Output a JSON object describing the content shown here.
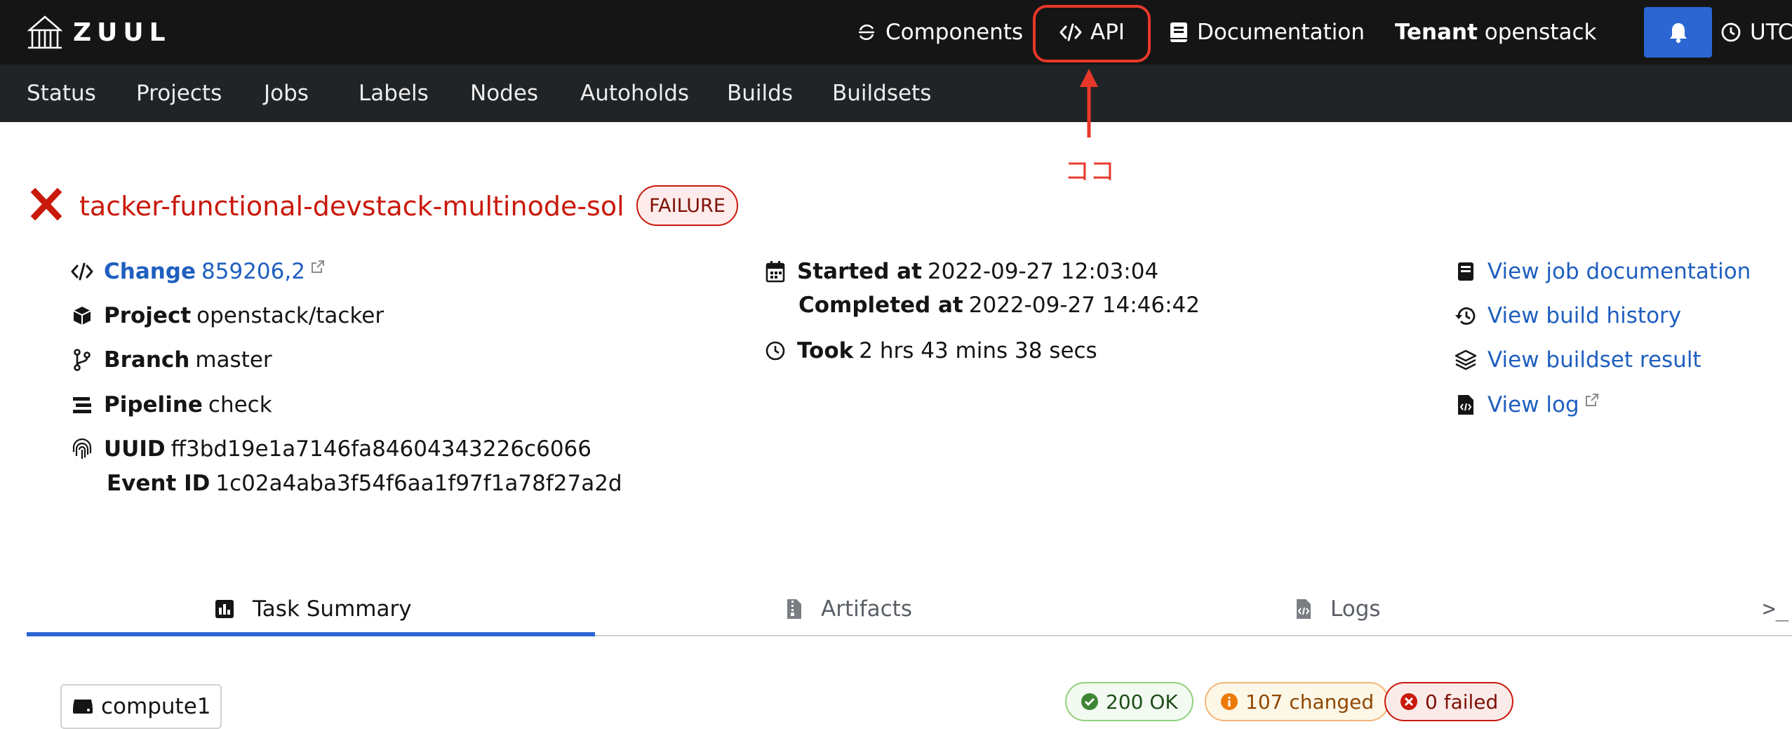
{
  "masthead": {
    "logo_text": "ZUUL",
    "components_label": "Components",
    "api_label": "API",
    "documentation_label": "Documentation",
    "tenant_prefix": "Tenant",
    "tenant_name": "openstack",
    "timezone_label": "UTC"
  },
  "nav": {
    "items": [
      "Status",
      "Projects",
      "Jobs",
      "Labels",
      "Nodes",
      "Autoholds",
      "Builds",
      "Buildsets"
    ]
  },
  "annotation": {
    "label": "ココ",
    "color": "#e8382a"
  },
  "build": {
    "job_name": "tacker-functional-devstack-multinode-sol",
    "result": "FAILURE",
    "change_label": "Change",
    "change_value": "859206,2",
    "project_label": "Project",
    "project_value": "openstack/tacker",
    "branch_label": "Branch",
    "branch_value": "master",
    "pipeline_label": "Pipeline",
    "pipeline_value": "check",
    "uuid_label": "UUID",
    "uuid_value": "ff3bd19e1a7146fa84604343226c6066",
    "event_id_label": "Event ID",
    "event_id_value": "1c02a4aba3f54f6aa1f97f1a78f27a2d",
    "started_label": "Started at",
    "started_value": "2022-09-27 12:03:04",
    "completed_label": "Completed at",
    "completed_value": "2022-09-27 14:46:42",
    "took_label": "Took",
    "took_value": "2 hrs 43 mins 38 secs"
  },
  "links": {
    "job_documentation": "View job documentation",
    "build_history": "View build history",
    "buildset_result": "View buildset result",
    "log": "View log"
  },
  "tabs": {
    "task_summary": "Task Summary",
    "artifacts": "Artifacts",
    "logs": "Logs",
    "console_glyph": ">_"
  },
  "summary": {
    "host": "compute1",
    "ok": "200 OK",
    "changed": "107 changed",
    "failed": "0 failed"
  },
  "colors": {
    "masthead_bg": "#151515",
    "nav_bg": "#212427",
    "link": "#1f5fbf",
    "danger": "#c9190b",
    "primary": "#2b66d2"
  }
}
